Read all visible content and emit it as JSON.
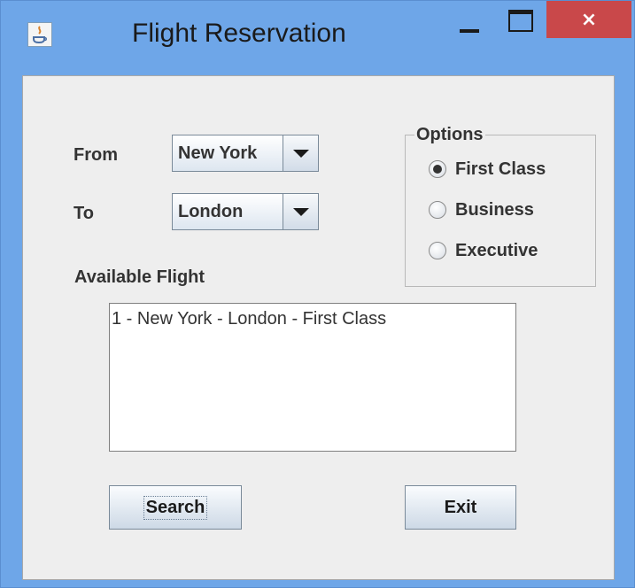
{
  "window": {
    "title": "Flight Reservation",
    "close_symbol": "×"
  },
  "form": {
    "from_label": "From",
    "from_value": "New York",
    "to_label": "To",
    "to_value": "London",
    "available_label": "Available Flight"
  },
  "options": {
    "title": "Options",
    "items": [
      {
        "label": "First Class",
        "selected": true
      },
      {
        "label": "Business",
        "selected": false
      },
      {
        "label": "Executive",
        "selected": false
      }
    ]
  },
  "flights": [
    "1 - New York - London - First Class"
  ],
  "buttons": {
    "search": "Search",
    "exit": "Exit"
  },
  "colors": {
    "titlebar": "#6ea6e8",
    "close_button": "#c9484a",
    "panel": "#eeeeee"
  }
}
